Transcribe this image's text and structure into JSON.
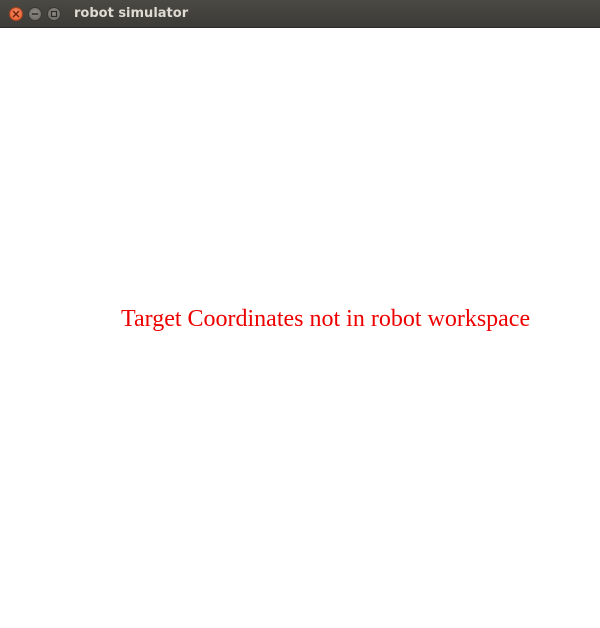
{
  "window": {
    "title": "robot simulator",
    "controls": {
      "close_icon": "close-icon",
      "minimize_icon": "minimize-icon",
      "maximize_icon": "maximize-icon"
    }
  },
  "canvas": {
    "message": "Target Coordinates not in robot workspace",
    "message_color": "#ee0000",
    "background": "#ffffff"
  }
}
